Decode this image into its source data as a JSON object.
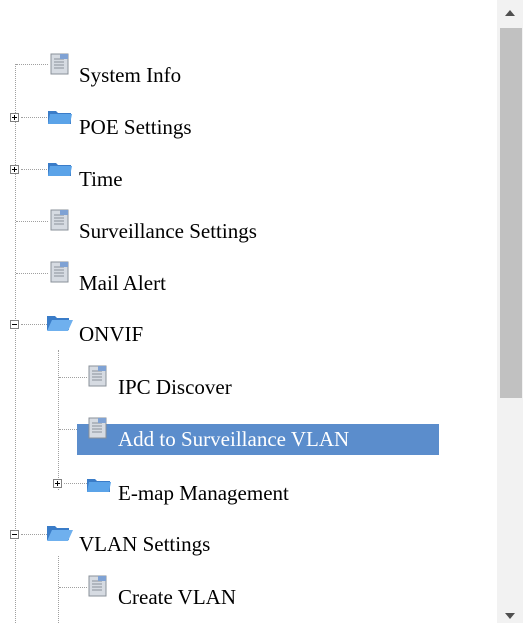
{
  "tree": {
    "items": [
      {
        "label": "System Info",
        "type": "page",
        "level": 0,
        "expander": "none"
      },
      {
        "label": "POE Settings",
        "type": "folder-closed",
        "level": 0,
        "expander": "plus"
      },
      {
        "label": "Time",
        "type": "folder-closed",
        "level": 0,
        "expander": "plus"
      },
      {
        "label": "Surveillance Settings",
        "type": "page",
        "level": 0,
        "expander": "none"
      },
      {
        "label": "Mail Alert",
        "type": "page",
        "level": 0,
        "expander": "none"
      },
      {
        "label": "ONVIF",
        "type": "folder-open",
        "level": 0,
        "expander": "minus"
      },
      {
        "label": "IPC Discover",
        "type": "page",
        "level": 1,
        "expander": "none"
      },
      {
        "label": "Add to Surveillance VLAN",
        "type": "page",
        "level": 1,
        "expander": "none",
        "selected": true
      },
      {
        "label": "E-map Management",
        "type": "folder-closed",
        "level": 1,
        "expander": "plus"
      },
      {
        "label": "VLAN Settings",
        "type": "folder-open",
        "level": 0,
        "expander": "minus"
      },
      {
        "label": "Create VLAN",
        "type": "page",
        "level": 1,
        "expander": "none"
      }
    ]
  },
  "colors": {
    "selection": "#5b8dcc",
    "folder": "#4a8fd6",
    "page": "#c8cdd4"
  },
  "icons": {
    "page": "document-icon",
    "folder-closed": "folder-icon",
    "folder-open": "folder-open-icon",
    "plus": "plus-box-icon",
    "minus": "minus-box-icon"
  }
}
